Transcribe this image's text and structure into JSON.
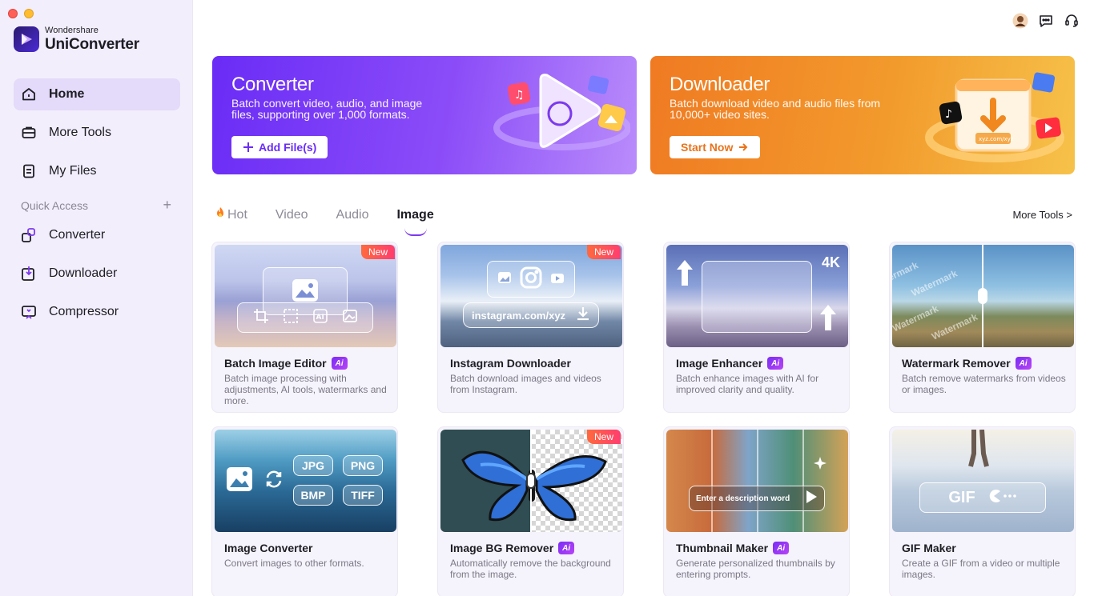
{
  "app": {
    "brand": "Wondershare",
    "product": "UniConverter"
  },
  "sidebar": {
    "items": [
      {
        "label": "Home",
        "icon": "home-icon",
        "active": true
      },
      {
        "label": "More Tools",
        "icon": "toolbox-icon",
        "active": false
      },
      {
        "label": "My Files",
        "icon": "files-icon",
        "active": false
      }
    ],
    "quick_access_label": "Quick Access",
    "quick_items": [
      {
        "label": "Converter",
        "icon": "converter-icon"
      },
      {
        "label": "Downloader",
        "icon": "downloader-icon"
      },
      {
        "label": "Compressor",
        "icon": "compressor-icon"
      }
    ]
  },
  "banners": {
    "converter": {
      "title": "Converter",
      "desc": "Batch convert video, audio, and image files, supporting over 1,000 formats.",
      "button": "Add File(s)"
    },
    "downloader": {
      "title": "Downloader",
      "desc": "Batch download video and audio files from 10,000+ video sites.",
      "button": "Start Now",
      "art_url": "xyz.com/xyz"
    }
  },
  "tabs": [
    {
      "label": "Hot",
      "active": false
    },
    {
      "label": "Video",
      "active": false
    },
    {
      "label": "Audio",
      "active": false
    },
    {
      "label": "Image",
      "active": true
    }
  ],
  "more_tools_link": "More Tools >",
  "badges": {
    "new": "New",
    "ai": "Ai"
  },
  "cards": [
    {
      "title": "Batch Image Editor",
      "ai": true,
      "new": true,
      "desc": "Batch image processing with adjustments, AI tools, watermarks and more."
    },
    {
      "title": "Instagram Downloader",
      "ai": false,
      "new": true,
      "desc": "Batch download images and videos from Instagram.",
      "overlay": "instagram.com/xyz"
    },
    {
      "title": "Image Enhancer",
      "ai": true,
      "new": false,
      "desc": "Batch enhance images with AI for improved clarity and quality.",
      "overlay": "4K"
    },
    {
      "title": "Watermark Remover",
      "ai": true,
      "new": false,
      "desc": "Batch remove watermarks from videos or images.",
      "overlay": "Watermark"
    },
    {
      "title": "Image Converter",
      "ai": false,
      "new": false,
      "desc": "Convert images to other formats.",
      "formats": [
        "JPG",
        "PNG",
        "BMP",
        "TIFF"
      ]
    },
    {
      "title": "Image BG Remover",
      "ai": true,
      "new": true,
      "desc": "Automatically remove the background from the image."
    },
    {
      "title": "Thumbnail Maker",
      "ai": true,
      "new": false,
      "desc": "Generate personalized thumbnails by entering prompts.",
      "overlay": "Enter a description word"
    },
    {
      "title": "GIF Maker",
      "ai": false,
      "new": false,
      "desc": "Create a GIF from a video or multiple images.",
      "overlay": "GIF"
    }
  ]
}
